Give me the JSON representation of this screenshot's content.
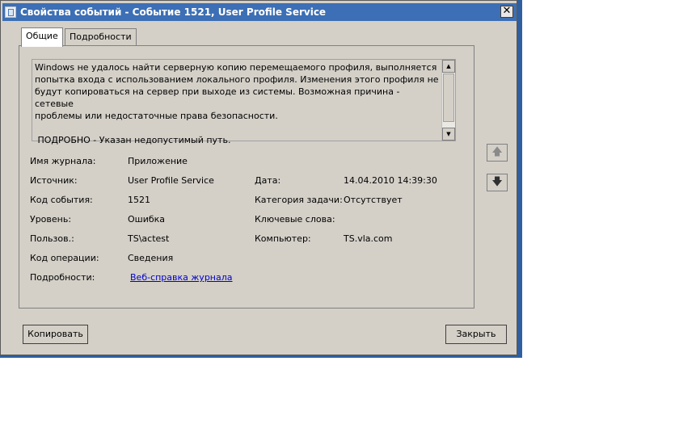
{
  "window": {
    "title": "Свойства событий - Событие 1521, User Profile Service",
    "close_glyph": "✕"
  },
  "tabs": [
    {
      "label": "Общие",
      "active": true
    },
    {
      "label": "Подробности",
      "active": false
    }
  ],
  "description": {
    "text": "Windows не удалось найти серверную копию перемещаемого профиля, выполняется\nпопытка входа с использованием локального профиля. Изменения этого профиля не\nбудут копироваться на сервер при выходе из системы. Возможная причина - сетевые\nпроблемы или недостаточные права безопасности.\n\n ПОДРОБНО - Указан недопустимый путь."
  },
  "fields": {
    "log_name": {
      "label": "Имя журнала:",
      "value": "Приложение"
    },
    "source": {
      "label": "Источник:",
      "value": "User Profile Service"
    },
    "event_id": {
      "label": "Код события:",
      "value": "1521"
    },
    "level": {
      "label": "Уровень:",
      "value": "Ошибка"
    },
    "user": {
      "label": "Пользов.:",
      "value": "TS\\actest"
    },
    "opcode": {
      "label": "Код операции:",
      "value": "Сведения"
    },
    "more_info": {
      "label": "Подробности:",
      "link": "Веб-справка журнала "
    },
    "date": {
      "label": "Дата:",
      "value": "14.04.2010 14:39:30"
    },
    "task_category": {
      "label": "Категория задачи:",
      "value": "Отсутствует"
    },
    "keywords": {
      "label": "Ключевые слова:",
      "value": ""
    },
    "computer": {
      "label": "Компьютер:",
      "value": "TS.vla.com"
    }
  },
  "nav": {
    "up_icon": "arrow-up",
    "down_icon": "arrow-down",
    "up_glyph": "🡅",
    "down_glyph": "🡇"
  },
  "buttons": {
    "copy": "Копировать",
    "close": "Закрыть"
  },
  "colors": {
    "titlebar": "#3c6fb5",
    "dialog_bg": "#d4d0c8",
    "link": "#0000cc",
    "desktop": "#2f5f9f"
  }
}
